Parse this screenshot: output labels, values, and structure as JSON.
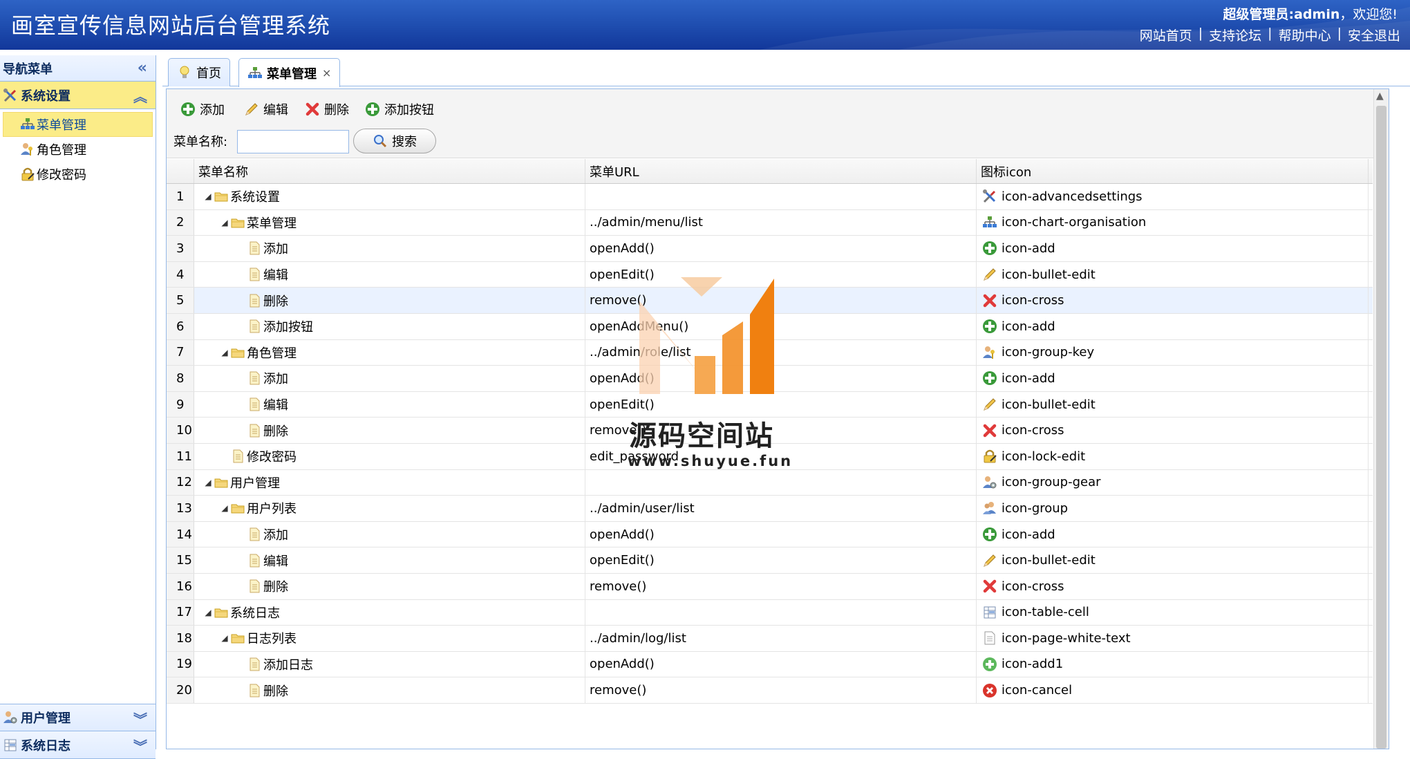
{
  "header": {
    "title": "画室宣传信息网站后台管理系统",
    "welcome_role": "超级管理员:admin",
    "welcome_text": "，欢迎您!",
    "links": [
      "网站首页",
      "支持论坛",
      "帮助中心",
      "安全退出"
    ],
    "separator": "|"
  },
  "nav": {
    "title": "导航菜单",
    "collapse_icon": "double-chevron-left-icon",
    "active_group": {
      "label": "系统设置",
      "icon": "tools-icon"
    },
    "items": [
      {
        "label": "菜单管理",
        "icon": "chart-organisation-icon",
        "selected": true
      },
      {
        "label": "角色管理",
        "icon": "group-key-icon",
        "selected": false
      },
      {
        "label": "修改密码",
        "icon": "lock-edit-icon",
        "selected": false
      }
    ],
    "bottom_groups": [
      {
        "label": "用户管理",
        "icon": "group-gear-icon"
      },
      {
        "label": "系统日志",
        "icon": "table-cell-icon"
      }
    ]
  },
  "tabs": [
    {
      "label": "首页",
      "icon": "lightbulb-icon",
      "active": false
    },
    {
      "label": "菜单管理",
      "icon": "chart-organisation-icon",
      "active": true,
      "close": "×"
    }
  ],
  "toolbar": {
    "add_label": "添加",
    "edit_label": "编辑",
    "delete_label": "删除",
    "add_button_label": "添加按钮",
    "search_label": "菜单名称:",
    "search_value": "",
    "search_button": "搜索"
  },
  "grid": {
    "columns": [
      "菜单名称",
      "菜单URL",
      "图标icon"
    ],
    "rows": [
      {
        "n": "1",
        "name": "系统设置",
        "url": "",
        "icon": "icon-advancedsettings"
      },
      {
        "n": "2",
        "name": "菜单管理",
        "url": "../admin/menu/list",
        "icon": "icon-chart-organisation"
      },
      {
        "n": "3",
        "name": "添加",
        "url": "openAdd()",
        "icon": "icon-add"
      },
      {
        "n": "4",
        "name": "编辑",
        "url": "openEdit()",
        "icon": "icon-bullet-edit"
      },
      {
        "n": "5",
        "name": "删除",
        "url": "remove()",
        "icon": "icon-cross"
      },
      {
        "n": "6",
        "name": "添加按钮",
        "url": "openAddMenu()",
        "icon": "icon-add"
      },
      {
        "n": "7",
        "name": "角色管理",
        "url": "../admin/role/list",
        "icon": "icon-group-key"
      },
      {
        "n": "8",
        "name": "添加",
        "url": "openAdd()",
        "icon": "icon-add"
      },
      {
        "n": "9",
        "name": "编辑",
        "url": "openEdit()",
        "icon": "icon-bullet-edit"
      },
      {
        "n": "10",
        "name": "删除",
        "url": "remove()",
        "icon": "icon-cross"
      },
      {
        "n": "11",
        "name": "修改密码",
        "url": "edit_password",
        "icon": "icon-lock-edit"
      },
      {
        "n": "12",
        "name": "用户管理",
        "url": "",
        "icon": "icon-group-gear"
      },
      {
        "n": "13",
        "name": "用户列表",
        "url": "../admin/user/list",
        "icon": "icon-group"
      },
      {
        "n": "14",
        "name": "添加",
        "url": "openAdd()",
        "icon": "icon-add"
      },
      {
        "n": "15",
        "name": "编辑",
        "url": "openEdit()",
        "icon": "icon-bullet-edit"
      },
      {
        "n": "16",
        "name": "删除",
        "url": "remove()",
        "icon": "icon-cross"
      },
      {
        "n": "17",
        "name": "系统日志",
        "url": "",
        "icon": "icon-table-cell"
      },
      {
        "n": "18",
        "name": "日志列表",
        "url": "../admin/log/list",
        "icon": "icon-page-white-text"
      },
      {
        "n": "19",
        "name": "添加日志",
        "url": "openAdd()",
        "icon": "icon-add1"
      },
      {
        "n": "20",
        "name": "删除",
        "url": "remove()",
        "icon": "icon-cancel"
      }
    ]
  },
  "watermark": {
    "text": "源码空间站",
    "url": "www.shuyue.fun"
  },
  "colors": {
    "header_blue": "#1f4eb0",
    "nav_border": "#95b8e7",
    "selected_yellow": "#fbec88",
    "row_highlight": "#eaf2ff",
    "watermark_orange": "#f39530"
  }
}
